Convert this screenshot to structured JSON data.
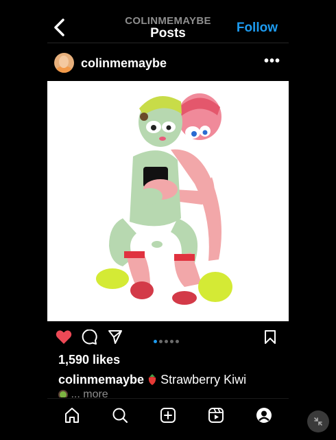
{
  "header": {
    "username": "COLINMEMAYBE",
    "title": "Posts",
    "follow_label": "Follow"
  },
  "post": {
    "username": "colinmemaybe",
    "more_label": "•••",
    "likes": "1,590 likes",
    "caption_user": "colinmemaybe",
    "caption_text": "Strawberry Kiwi",
    "caption_more": "... more",
    "carousel_count": 5,
    "carousel_active": 1
  },
  "colors": {
    "like_red": "#ed4956",
    "link_blue": "#1d9bf0"
  },
  "icons": {
    "actions": [
      "heart-icon",
      "comment-icon",
      "share-icon",
      "bookmark-icon"
    ],
    "tabs": [
      "home-icon",
      "search-icon",
      "create-icon",
      "reels-icon",
      "profile-icon"
    ]
  }
}
